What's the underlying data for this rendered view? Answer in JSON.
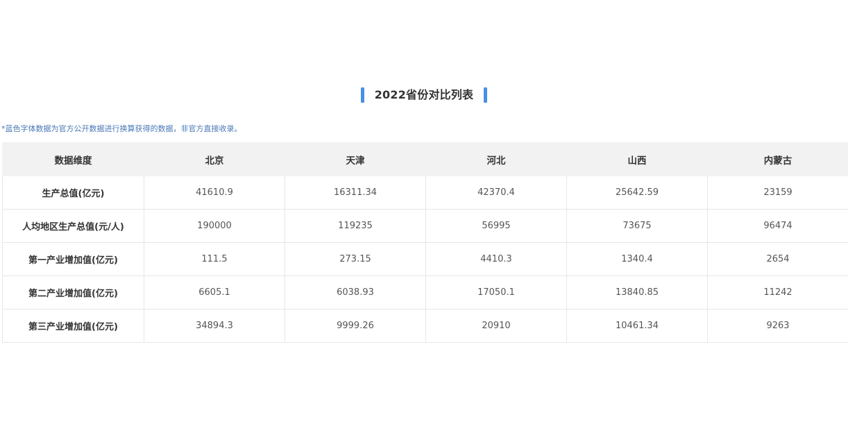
{
  "title": "2022省份对比列表",
  "note": "*蓝色字体数据为官方公开数据进行换算获得的数据，非官方直接收录。",
  "colors": {
    "accent": "#4a90e2",
    "note_text": "#4a78b8",
    "header_bg": "#f2f2f2",
    "border": "#e6e6e6"
  },
  "table": {
    "headers": [
      "数据维度",
      "北京",
      "天津",
      "河北",
      "山西",
      "内蒙古"
    ],
    "rows": [
      {
        "label": "生产总值(亿元)",
        "values": [
          "41610.9",
          "16311.34",
          "42370.4",
          "25642.59",
          "23159"
        ]
      },
      {
        "label": "人均地区生产总值(元/人)",
        "values": [
          "190000",
          "119235",
          "56995",
          "73675",
          "96474"
        ]
      },
      {
        "label": "第一产业增加值(亿元)",
        "values": [
          "111.5",
          "273.15",
          "4410.3",
          "1340.4",
          "2654"
        ]
      },
      {
        "label": "第二产业增加值(亿元)",
        "values": [
          "6605.1",
          "6038.93",
          "17050.1",
          "13840.85",
          "11242"
        ]
      },
      {
        "label": "第三产业增加值(亿元)",
        "values": [
          "34894.3",
          "9999.26",
          "20910",
          "10461.34",
          "9263"
        ]
      }
    ]
  }
}
